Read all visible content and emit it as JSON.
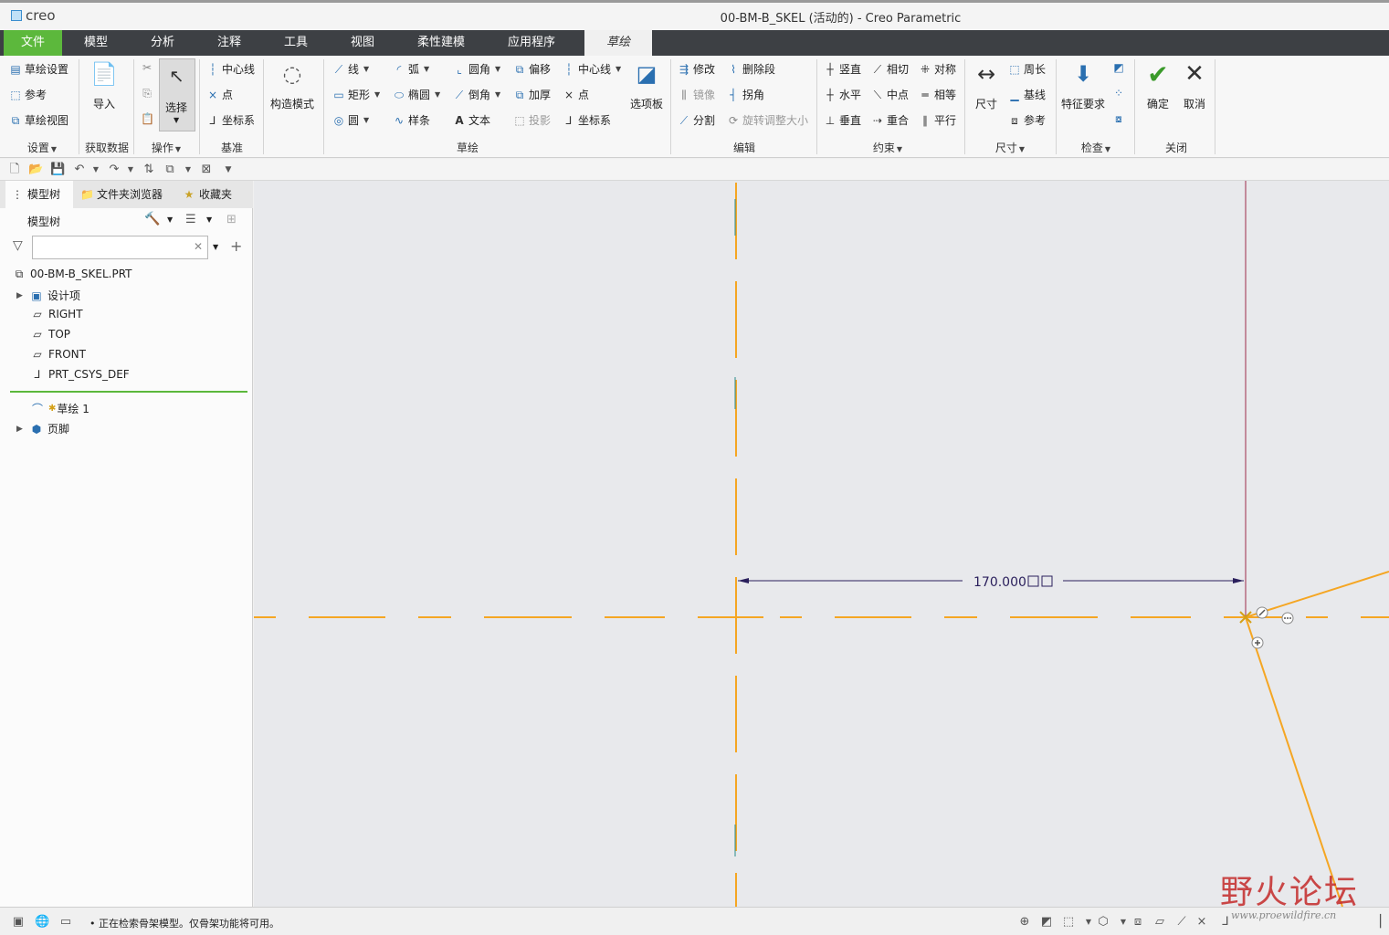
{
  "window": {
    "logo": "creo",
    "title": "00-BM-B_SKEL (活动的) - Creo Parametric"
  },
  "menu_tabs": [
    "文件",
    "模型",
    "分析",
    "注释",
    "工具",
    "视图",
    "柔性建模",
    "应用程序",
    "草绘"
  ],
  "ribbon": {
    "setup": {
      "sketch_setup": "草绘设置",
      "reference": "参考",
      "sketch_view": "草绘视图",
      "group": "设置"
    },
    "get_data": {
      "import": "导入",
      "group": "获取数据"
    },
    "operations": {
      "select": "选择",
      "group": "操作"
    },
    "datum": {
      "centerline": "中心线",
      "point": "点",
      "csys": "坐标系",
      "group": "基准"
    },
    "construction": {
      "mode": "构造模式"
    },
    "sketch": {
      "line": "线",
      "rectangle": "矩形",
      "circle": "圆",
      "arc": "弧",
      "ellipse": "椭圆",
      "spline": "样条",
      "fillet": "圆角",
      "chamfer": "倒角",
      "text": "文本",
      "offset": "偏移",
      "thicken": "加厚",
      "project": "投影",
      "centerline": "中心线",
      "point": "点",
      "csys": "坐标系",
      "palette": "选项板",
      "group": "草绘"
    },
    "editing": {
      "modify": "修改",
      "delete_segment": "删除段",
      "mirror": "镜像",
      "corner": "拐角",
      "divide": "分割",
      "rotate_resize": "旋转调整大小",
      "group": "编辑"
    },
    "constrain": {
      "vertical": "竖直",
      "tangent": "相切",
      "symmetric": "对称",
      "horizontal": "水平",
      "midpoint": "中点",
      "equal": "相等",
      "perpendicular": "垂直",
      "coincident": "重合",
      "parallel": "平行",
      "group": "约束"
    },
    "dimension": {
      "dimension": "尺寸",
      "perimeter": "周长",
      "baseline": "基线",
      "reference": "参考",
      "group": "尺寸"
    },
    "inspect": {
      "feature_requirements": "特征要求",
      "group": "检查"
    },
    "close": {
      "ok": "确定",
      "cancel": "取消",
      "group": "关闭"
    }
  },
  "navigator": {
    "tabs": [
      "模型树",
      "文件夹浏览器",
      "收藏夹"
    ],
    "header": "模型树",
    "filter_placeholder": "",
    "items": [
      {
        "label": "00-BM-B_SKEL.PRT"
      },
      {
        "label": "设计项"
      },
      {
        "label": "RIGHT"
      },
      {
        "label": "TOP"
      },
      {
        "label": "FRONT"
      },
      {
        "label": "PRT_CSYS_DEF"
      },
      {
        "label": "草绘 1"
      },
      {
        "label": "页脚"
      }
    ]
  },
  "sketch": {
    "dimension_value": "170.000",
    "colors": {
      "centerline": "#f5a623",
      "dimension": "#2a1f5c",
      "geometry": "#f5a623",
      "vertical_ref": "#9b2a4a"
    }
  },
  "status": {
    "message": "正在检索骨架模型。仅骨架功能将可用。"
  },
  "watermark": {
    "text": "野火论坛",
    "url": "www.proewildfire.cn"
  }
}
